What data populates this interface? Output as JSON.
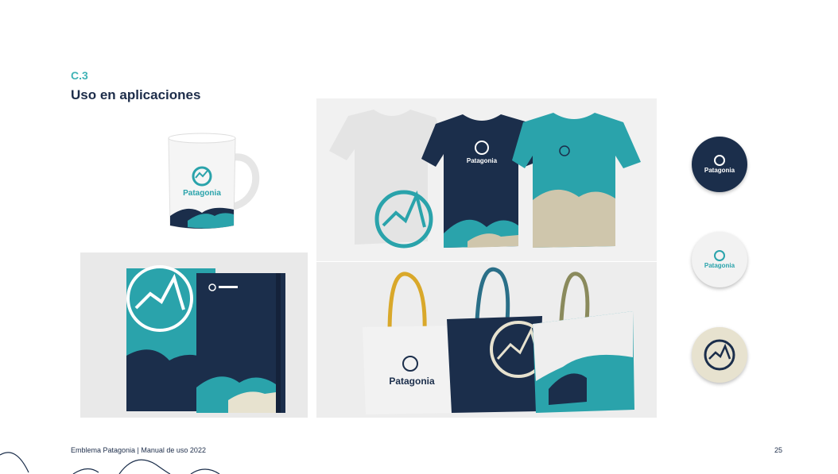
{
  "section": {
    "code": "C.3",
    "title": "Uso en aplicaciones"
  },
  "brand": {
    "name": "Patagonia"
  },
  "footer": {
    "text": "Emblema Patagonia | Manual de uso 2022",
    "page_number": "25"
  },
  "colors": {
    "teal": "#2aa3ab",
    "navy": "#1b2e4b",
    "cream": "#e7e2cf",
    "sand": "#cfc6ac",
    "mustard": "#d9a82a",
    "olive": "#8a8a5c"
  },
  "items": {
    "mug": "mug-mockup",
    "tshirts": "tshirts-mockup",
    "notebooks": "notebooks-mockup",
    "totes": "tote-bags-mockup",
    "buttons": [
      "button-navy",
      "button-white",
      "button-cream"
    ]
  }
}
